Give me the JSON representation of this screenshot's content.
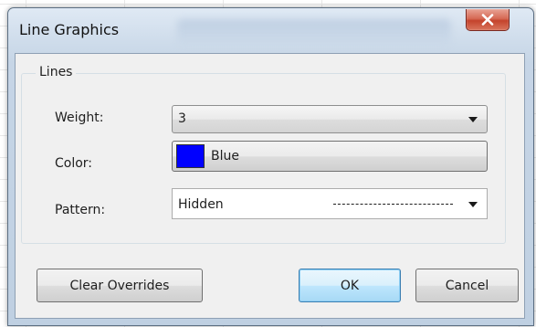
{
  "dialog": {
    "title": "Line Graphics"
  },
  "lines": {
    "group_label": "Lines",
    "weight": {
      "label": "Weight:",
      "value": "3"
    },
    "color": {
      "label": "Color:",
      "value": "Blue",
      "swatch": "#0000ff"
    },
    "pattern": {
      "label": "Pattern:",
      "value": "Hidden"
    }
  },
  "buttons": {
    "clear_overrides": "Clear Overrides",
    "ok": "OK",
    "cancel": "Cancel"
  },
  "icons": {
    "close": "close-icon",
    "dropdown": "chevron-down-icon"
  }
}
